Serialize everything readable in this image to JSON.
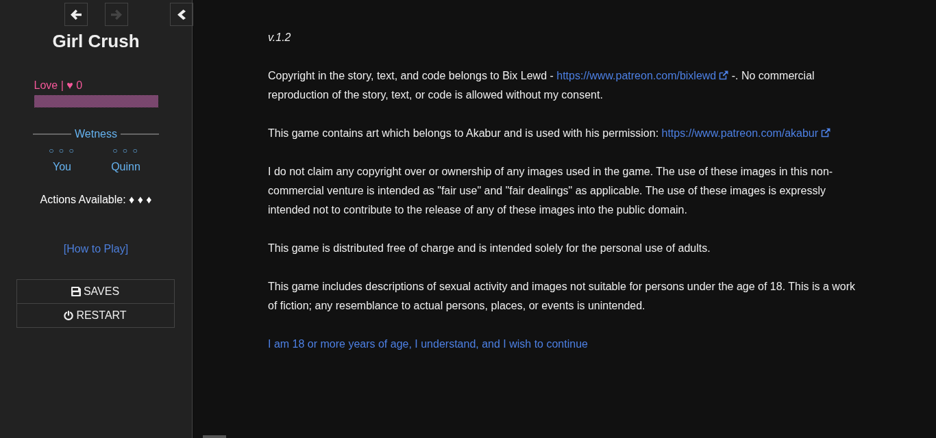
{
  "history_buttons": [
    {
      "kind": "back",
      "disabled": false
    },
    {
      "kind": "forward",
      "disabled": true
    }
  ],
  "story_title": "Girl Crush",
  "love": {
    "label": "Love | ♥ 0"
  },
  "wetness": {
    "title": "Wetness",
    "people": [
      {
        "marks": "○ ○ ○",
        "name": "You"
      },
      {
        "marks": "○ ○ ○",
        "name": "Quinn"
      }
    ]
  },
  "actions": "Actions Available: ♦ ♦ ♦",
  "how_to_play": "[How to Play]",
  "menu": [
    {
      "kind": "saves",
      "label": "SAVES"
    },
    {
      "kind": "restart",
      "label": "RESTART"
    }
  ],
  "passage": {
    "version": "v.1.2",
    "paragraphs": [
      {
        "parts": [
          {
            "kind": "text",
            "text": "Copyright in the story, text, and code belongs to Bix Lewd - "
          },
          {
            "kind": "link",
            "text": "https://www.patreon.com/bixlewd",
            "external": true
          },
          {
            "kind": "text",
            "text": " -. No commercial reproduction of the story, text, or code is allowed without my consent."
          }
        ]
      },
      {
        "parts": [
          {
            "kind": "text",
            "text": "This game contains art which belongs to Akabur and is used with his permission: "
          },
          {
            "kind": "link",
            "text": "https://www.patreon.com/akabur",
            "external": true
          }
        ]
      },
      {
        "parts": [
          {
            "kind": "text",
            "text": "I do not claim any copyright over or ownership of any images used in the game. The use of these images in this non-commercial venture is intended as \"fair use\" and \"fair dealings\" as applicable. The use of these images is expressly intended not to contribute to the release of any of these images into the public domain."
          }
        ]
      },
      {
        "parts": [
          {
            "kind": "text",
            "text": "This game is distributed free of charge and is intended solely for the personal use of adults."
          }
        ]
      },
      {
        "parts": [
          {
            "kind": "text",
            "text": "This game includes descriptions of sexual activity and images not suitable for persons under the age of 18. This is a work of fiction; any resemblance to actual persons, places, or events is unintended."
          }
        ]
      }
    ],
    "continue": "I am 18 or more years of age, I understand, and I wish to continue"
  }
}
